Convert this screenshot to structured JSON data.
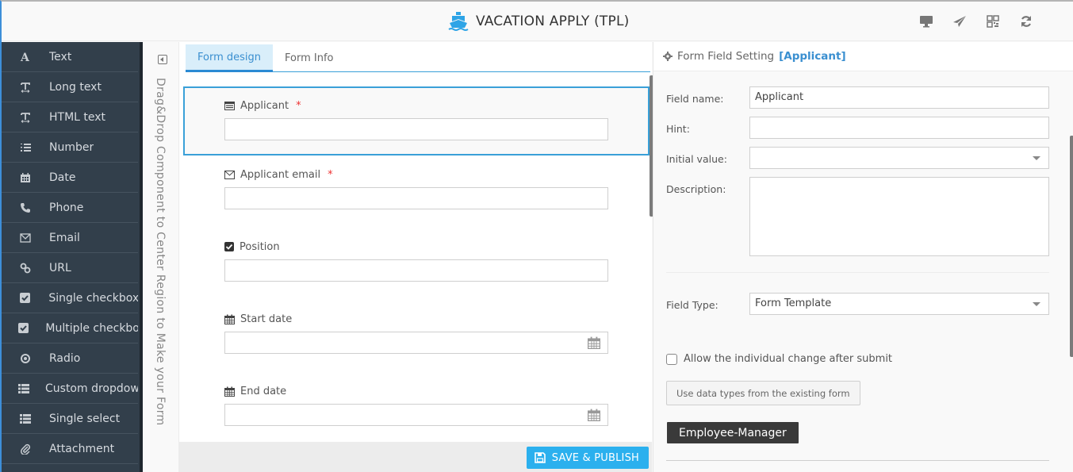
{
  "header": {
    "title": "VACATION APPLY (TPL)",
    "logo_icon": "ship-icon",
    "tools": [
      {
        "name": "desktop-preview",
        "icon": "desktop-icon"
      },
      {
        "name": "send",
        "icon": "paper-plane-icon"
      },
      {
        "name": "qr-code",
        "icon": "qrcode-icon"
      },
      {
        "name": "refresh",
        "icon": "refresh-icon"
      }
    ]
  },
  "sidebar": {
    "items": [
      {
        "label": "Text",
        "icon": "font-icon"
      },
      {
        "label": "Long text",
        "icon": "text-width-icon"
      },
      {
        "label": "HTML text",
        "icon": "text-width-icon"
      },
      {
        "label": "Number",
        "icon": "ordered-list-icon"
      },
      {
        "label": "Date",
        "icon": "calendar-icon"
      },
      {
        "label": "Phone",
        "icon": "phone-icon"
      },
      {
        "label": "Email",
        "icon": "envelope-icon"
      },
      {
        "label": "URL",
        "icon": "link-icon"
      },
      {
        "label": "Single checkbox",
        "icon": "checkbox-icon"
      },
      {
        "label": "Multiple checkbox",
        "icon": "checkbox-icon"
      },
      {
        "label": "Radio",
        "icon": "radio-icon"
      },
      {
        "label": "Custom dropdown",
        "icon": "list-icon"
      },
      {
        "label": "Single select",
        "icon": "list-icon"
      },
      {
        "label": "Attachment",
        "icon": "paperclip-icon"
      }
    ]
  },
  "strip": {
    "hint": "Drag&Drop Component to Center Region to Make your Form"
  },
  "center": {
    "tabs": [
      {
        "label": "Form design",
        "active": true
      },
      {
        "label": "Form Info",
        "active": false
      }
    ],
    "fields": [
      {
        "label": "Applicant",
        "required": true,
        "icon": "id-card-icon",
        "value": "",
        "selected": true,
        "date": false
      },
      {
        "label": "Applicant email",
        "required": true,
        "icon": "envelope-icon",
        "value": "",
        "selected": false,
        "date": false
      },
      {
        "label": "Position",
        "required": false,
        "icon": "checkbox-icon",
        "value": "",
        "selected": false,
        "date": false
      },
      {
        "label": "Start date",
        "required": false,
        "icon": "calendar-icon",
        "value": "",
        "selected": false,
        "date": true
      },
      {
        "label": "End date",
        "required": false,
        "icon": "calendar-icon",
        "value": "",
        "selected": false,
        "date": true
      }
    ],
    "save_label": "SAVE & PUBLISH"
  },
  "settings": {
    "title": "Form Field Setting",
    "selected_field": "[Applicant]",
    "field_name_label": "Field name:",
    "field_name_value": "Applicant",
    "hint_label": "Hint:",
    "hint_value": "",
    "initial_value_label": "Initial value:",
    "initial_value_value": "",
    "description_label": "Description:",
    "description_value": "",
    "field_type_label": "Field Type:",
    "field_type_value": "Form Template",
    "allow_change_label": "Allow the individual change after submit",
    "allow_change_checked": false,
    "use_data_types_label": "Use data types from the existing form",
    "template_tag": "Employee-Manager"
  },
  "colors": {
    "accent": "#3aa0d8",
    "save_button": "#2bb0ee",
    "sidebar_bg": "#323f4b",
    "required": "#ee3333",
    "tag_bg": "#3a3a3a"
  }
}
